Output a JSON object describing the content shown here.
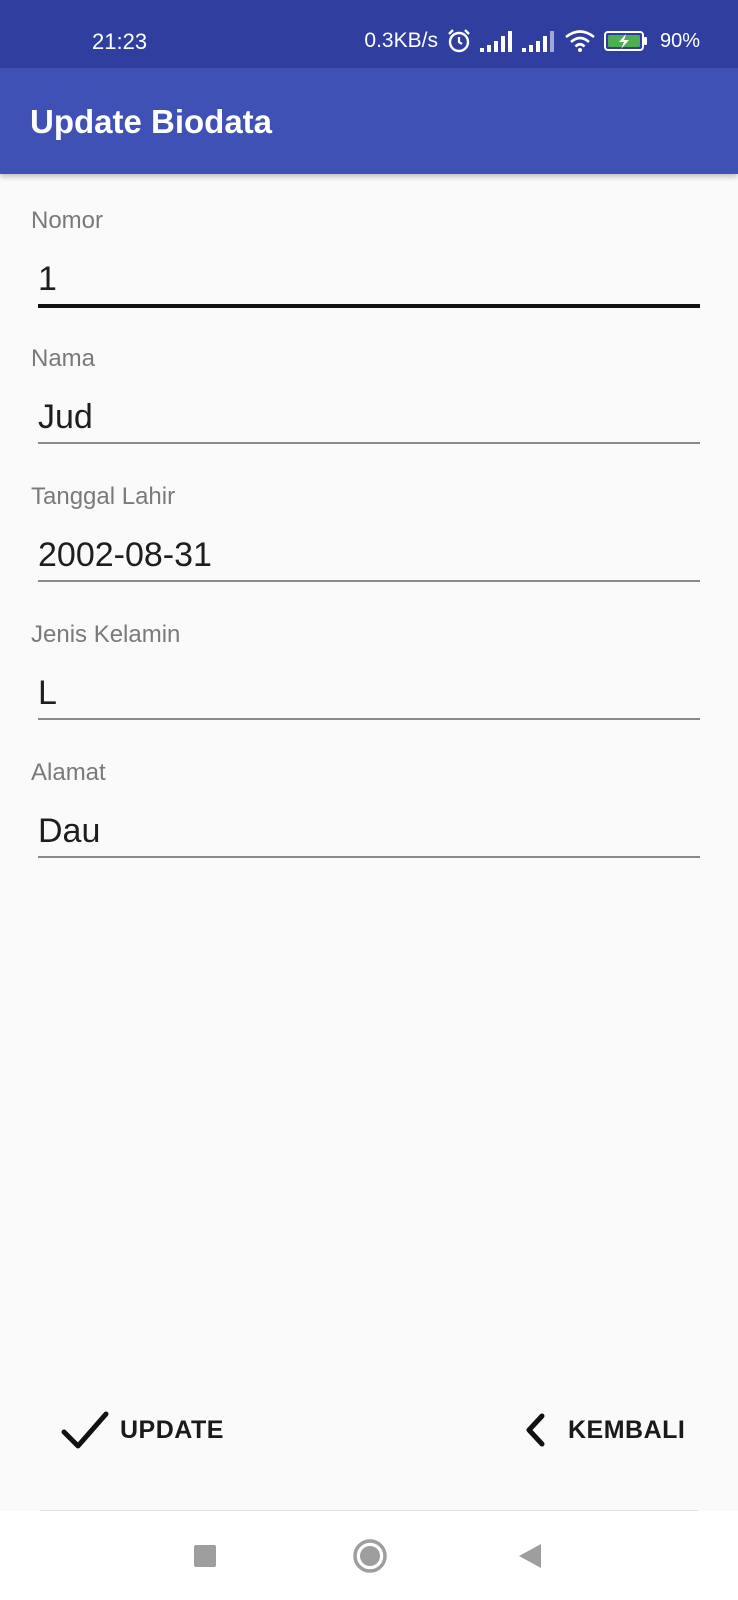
{
  "status_bar": {
    "time": "21:23",
    "network_speed": "0.3KB/s",
    "battery": "90%",
    "icons": [
      "alarm-icon",
      "signal-icon",
      "signal-icon",
      "wifi-icon",
      "battery-charging-icon"
    ]
  },
  "app_bar": {
    "title": "Update Biodata",
    "color": "#3f51b5"
  },
  "form": {
    "fields": [
      {
        "label": "Nomor",
        "value": "1",
        "focused": true
      },
      {
        "label": "Nama",
        "value": "Jud"
      },
      {
        "label": "Tanggal Lahir",
        "value": "2002-08-31"
      },
      {
        "label": "Jenis Kelamin",
        "value": "L"
      },
      {
        "label": "Alamat",
        "value": "Dau"
      }
    ]
  },
  "buttons": {
    "update_label": "UPDATE",
    "update_icon": "check-icon",
    "back_label": "KEMBALI",
    "back_icon": "chevron-left-icon"
  },
  "nav_bar": {
    "icons": [
      "recent-apps-icon",
      "home-icon",
      "back-icon"
    ]
  }
}
